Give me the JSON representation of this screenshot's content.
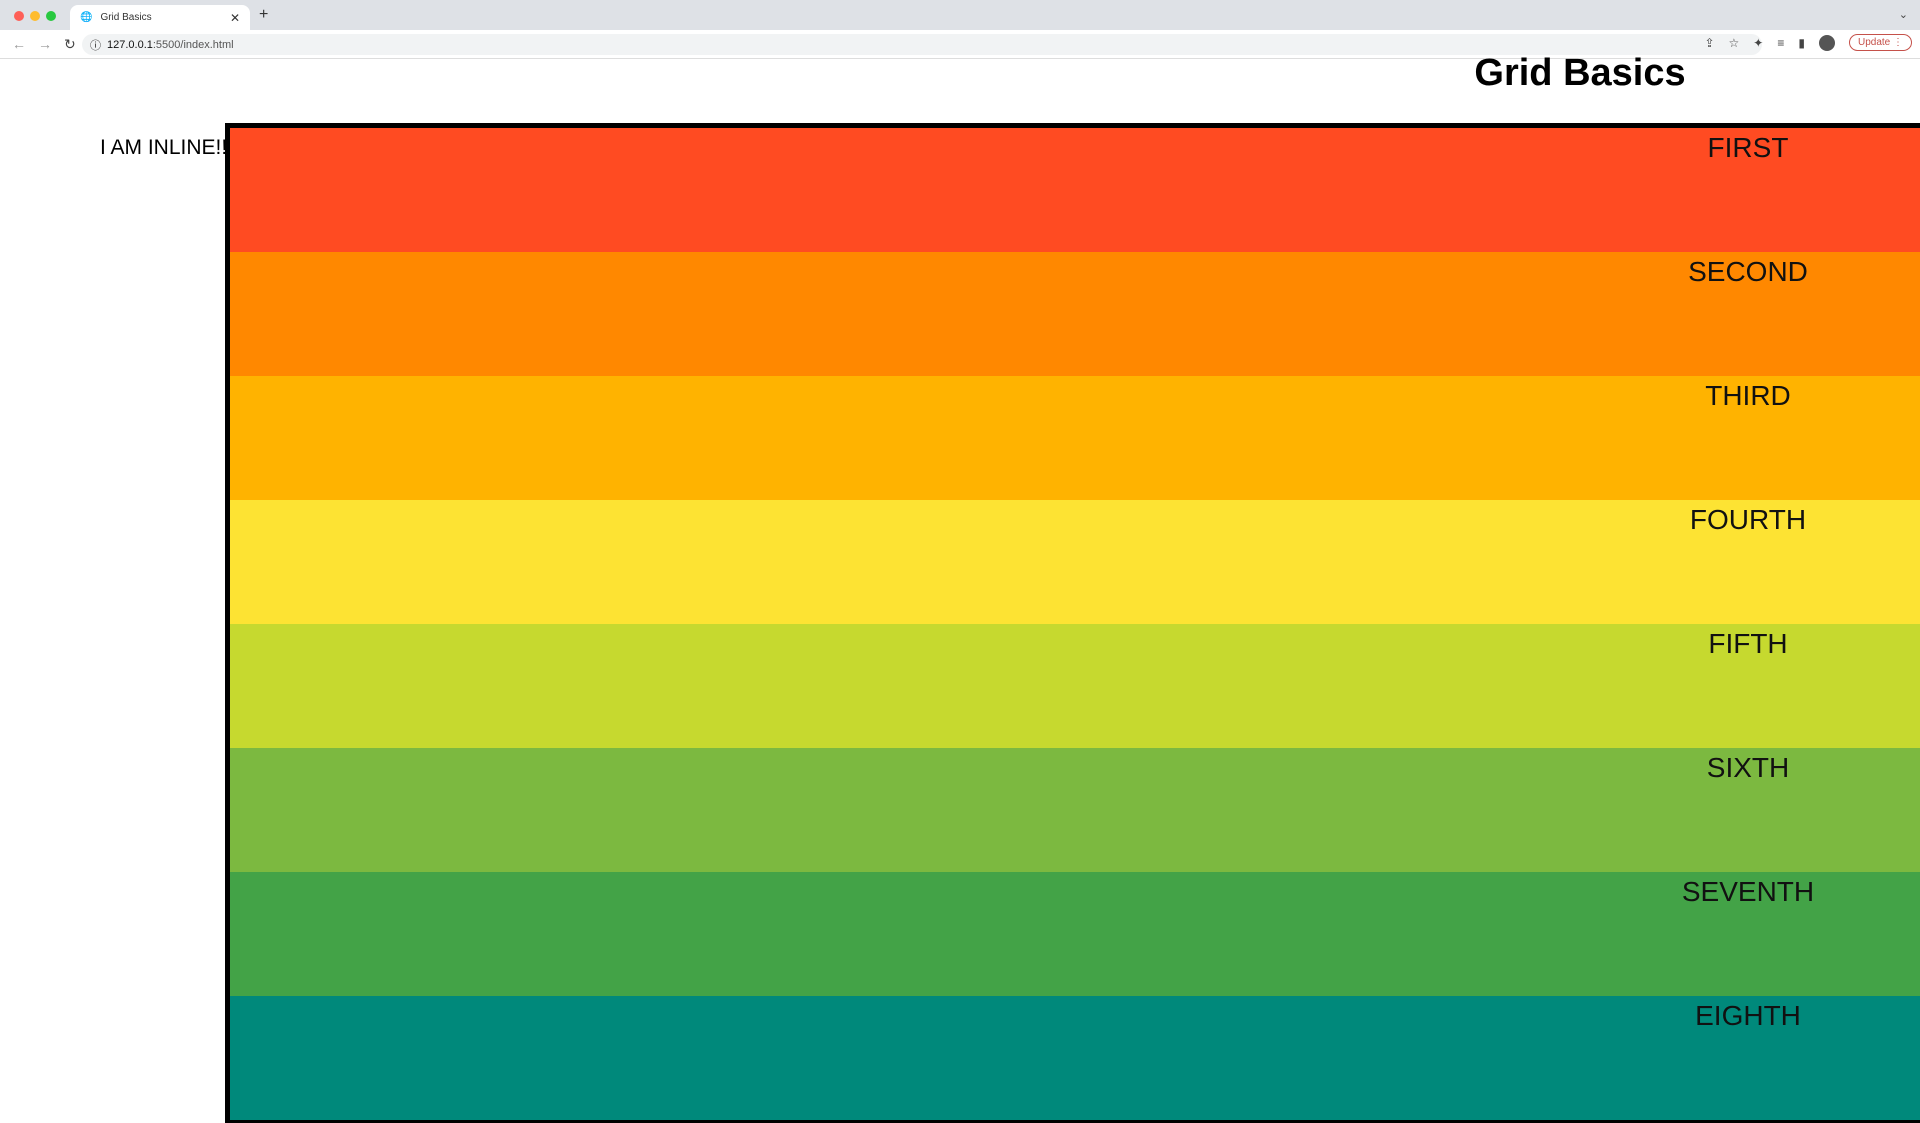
{
  "browser": {
    "tab_title": "Grid Basics",
    "url_host": "127.0.0.1",
    "url_path": ":5500/index.html",
    "update_label": "Update",
    "icons": [
      "globe-icon",
      "close-icon",
      "plus-icon",
      "back-icon",
      "forward-icon",
      "reload-icon",
      "info-icon",
      "share-icon",
      "star-icon",
      "extensions-icon",
      "media-icon",
      "sidepanel-icon",
      "profile-avatar",
      "more-icon"
    ]
  },
  "page": {
    "title": "Grid Basics",
    "inline_text": "I AM INLINE!!",
    "rows": [
      {
        "label": "FIRST",
        "color": "#FF4B22"
      },
      {
        "label": "SECOND",
        "color": "#FF8800"
      },
      {
        "label": "THIRD",
        "color": "#FFB300"
      },
      {
        "label": "FOURTH",
        "color": "#FDE333"
      },
      {
        "label": "FIFTH",
        "color": "#C6D92F"
      },
      {
        "label": "SIXTH",
        "color": "#7CB940"
      },
      {
        "label": "SEVENTH",
        "color": "#43A347"
      },
      {
        "label": "EIGHTH",
        "color": "#00897B"
      }
    ]
  }
}
